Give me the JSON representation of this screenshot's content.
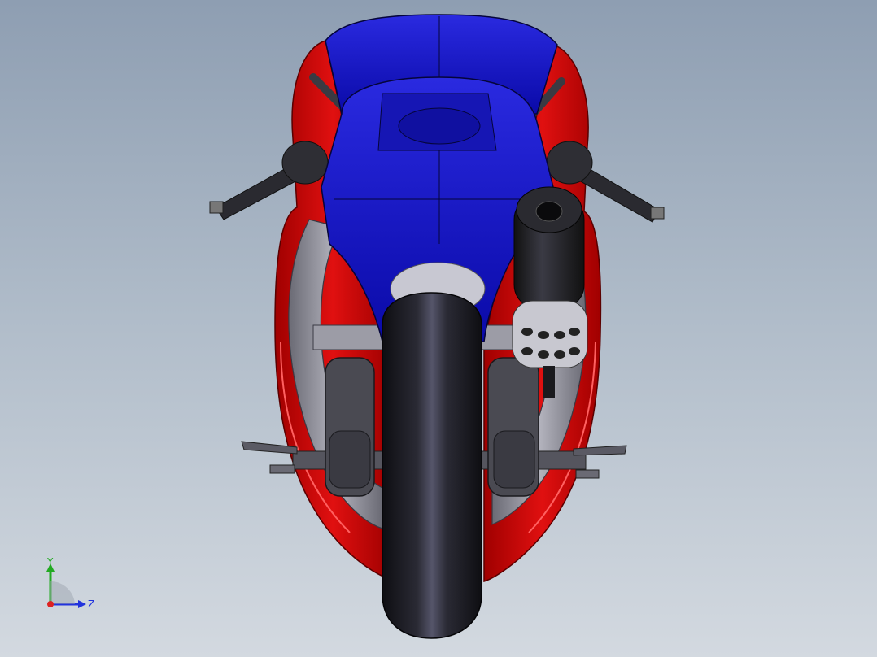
{
  "viewport": {
    "background_top": "#8e9eb2",
    "background_bottom": "#d3d9e0",
    "model_colors": {
      "fairing_red": "#d40000",
      "body_blue": "#1a1acc",
      "tire_black": "#1c1c22",
      "frame_gray": "#8c8c96",
      "exhaust_silver": "#c8c8d0"
    }
  },
  "triad": {
    "y_label": "Y",
    "z_label": "Z",
    "y_color": "#22aa22",
    "z_color": "#2233dd",
    "x_color": "#dd2222"
  }
}
